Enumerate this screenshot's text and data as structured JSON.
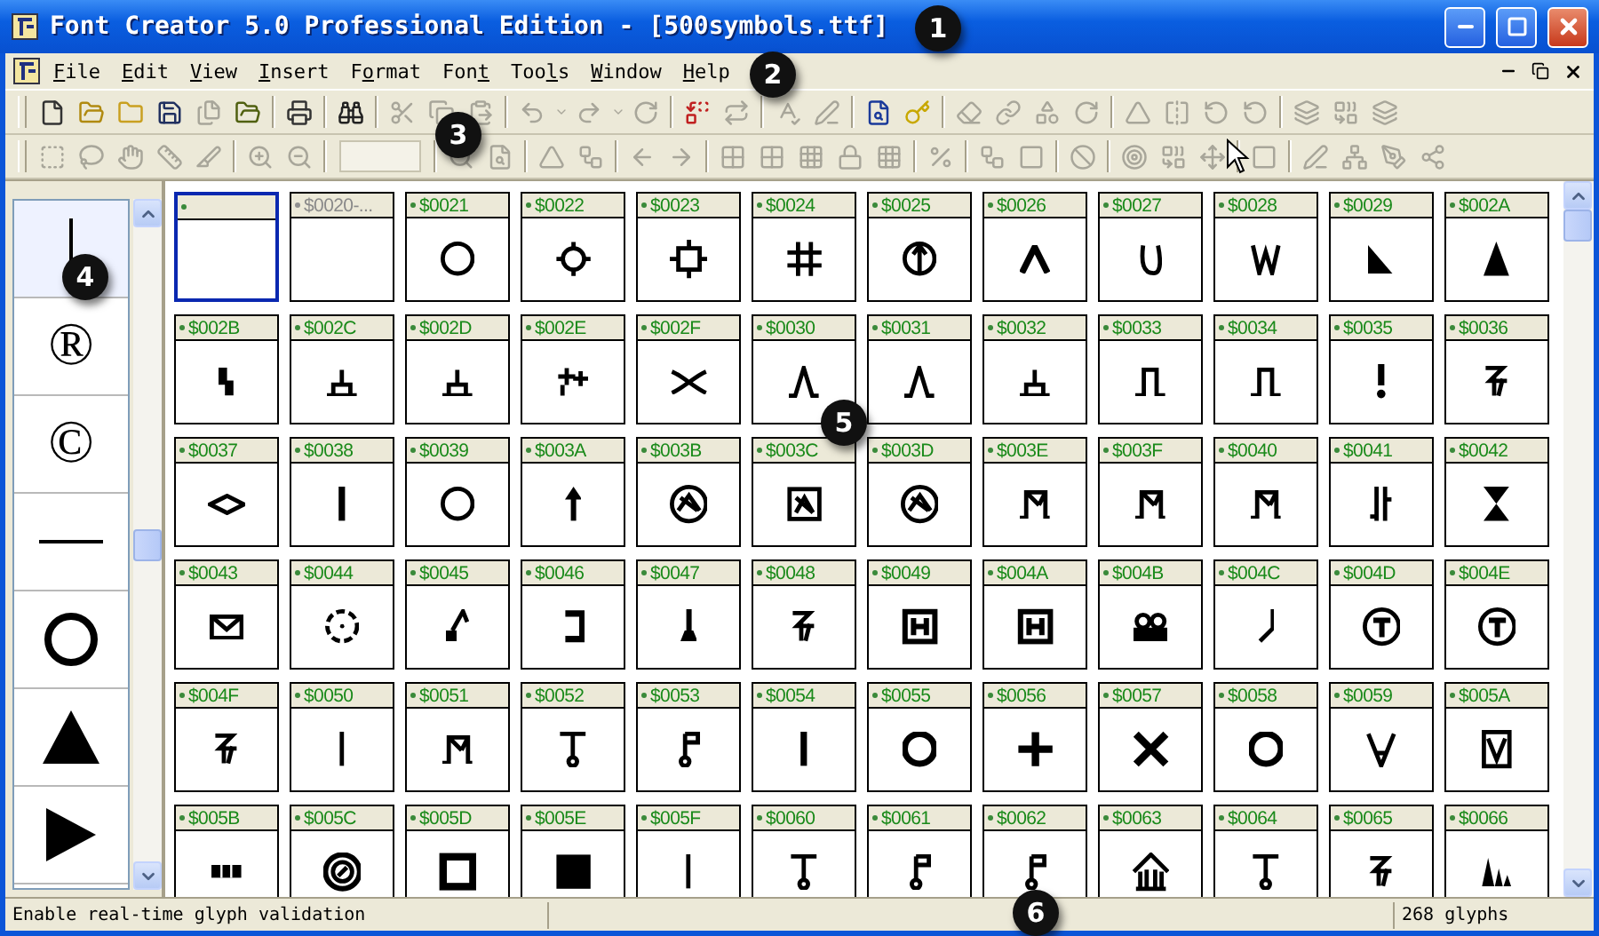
{
  "window": {
    "title": "Font Creator 5.0 Professional Edition - [500symbols.ttf]"
  },
  "menu": [
    {
      "key": "F",
      "post": "ile"
    },
    {
      "key": "E",
      "post": "dit"
    },
    {
      "key": "V",
      "post": "iew"
    },
    {
      "key": "I",
      "post": "nsert"
    },
    {
      "pre": "F",
      "key": "o",
      "post": "rmat"
    },
    {
      "pre": "Fon",
      "key": "t"
    },
    {
      "pre": "Too",
      "key": "l",
      "post": "s"
    },
    {
      "key": "W",
      "post": "indow"
    },
    {
      "key": "H",
      "post": "elp"
    }
  ],
  "toolbar_1": [
    {
      "kind": "new",
      "disabled": false
    },
    {
      "kind": "open-font",
      "disabled": false
    },
    {
      "kind": "open",
      "disabled": false
    },
    {
      "kind": "save",
      "disabled": false
    },
    {
      "kind": "save-all",
      "disabled": true
    },
    {
      "kind": "export",
      "disabled": false
    },
    {
      "kind": "separator"
    },
    {
      "kind": "print",
      "disabled": false
    },
    {
      "kind": "separator"
    },
    {
      "kind": "find",
      "disabled": false
    },
    {
      "kind": "separator"
    },
    {
      "kind": "cut",
      "disabled": true
    },
    {
      "kind": "copy",
      "disabled": true
    },
    {
      "kind": "paste",
      "disabled": true
    },
    {
      "kind": "separator"
    },
    {
      "kind": "undo",
      "disabled": true
    },
    {
      "kind": "dropdown",
      "disabled": true
    },
    {
      "kind": "redo",
      "disabled": true
    },
    {
      "kind": "dropdown",
      "disabled": true
    },
    {
      "kind": "refresh",
      "disabled": true
    },
    {
      "kind": "separator"
    },
    {
      "kind": "replace",
      "disabled": false
    },
    {
      "kind": "swap",
      "disabled": true
    },
    {
      "kind": "separator"
    },
    {
      "kind": "spell",
      "disabled": true
    },
    {
      "kind": "pen",
      "disabled": true
    },
    {
      "kind": "separator"
    },
    {
      "kind": "preview",
      "disabled": false
    },
    {
      "kind": "key",
      "disabled": false
    },
    {
      "kind": "separator"
    },
    {
      "kind": "eraser",
      "disabled": true
    },
    {
      "kind": "link",
      "disabled": true
    },
    {
      "kind": "shapes",
      "disabled": true
    },
    {
      "kind": "refresh",
      "disabled": true
    },
    {
      "kind": "separator"
    },
    {
      "kind": "triangle",
      "disabled": true
    },
    {
      "kind": "flip",
      "disabled": true
    },
    {
      "kind": "rotate",
      "disabled": true
    },
    {
      "kind": "rotate",
      "disabled": true
    },
    {
      "kind": "separator"
    },
    {
      "kind": "layers",
      "disabled": true
    },
    {
      "kind": "combine",
      "disabled": true
    },
    {
      "kind": "layers",
      "disabled": true
    }
  ],
  "toolbar_2": [
    {
      "kind": "select",
      "disabled": true
    },
    {
      "kind": "lasso",
      "disabled": true
    },
    {
      "kind": "hand",
      "disabled": true
    },
    {
      "kind": "ruler",
      "disabled": true
    },
    {
      "kind": "knife",
      "disabled": true
    },
    {
      "kind": "separator"
    },
    {
      "kind": "zoom-in",
      "disabled": true
    },
    {
      "kind": "zoom-out",
      "disabled": true
    },
    {
      "kind": "separator"
    },
    {
      "kind": "field",
      "disabled": true
    },
    {
      "kind": "separator"
    },
    {
      "kind": "search",
      "disabled": true
    },
    {
      "kind": "preview",
      "disabled": true
    },
    {
      "kind": "separator"
    },
    {
      "kind": "triangle",
      "disabled": true
    },
    {
      "kind": "nodes",
      "disabled": true
    },
    {
      "kind": "separator"
    },
    {
      "kind": "arrow-left",
      "disabled": true
    },
    {
      "kind": "arrow-right",
      "disabled": true
    },
    {
      "kind": "separator"
    },
    {
      "kind": "grid",
      "disabled": true
    },
    {
      "kind": "grid",
      "disabled": true
    },
    {
      "kind": "grid-fine",
      "disabled": true
    },
    {
      "kind": "lock",
      "disabled": true
    },
    {
      "kind": "grid-fine",
      "disabled": true
    },
    {
      "kind": "separator"
    },
    {
      "kind": "percent",
      "disabled": true
    },
    {
      "kind": "separator"
    },
    {
      "kind": "nodes",
      "disabled": true
    },
    {
      "kind": "square",
      "disabled": true
    },
    {
      "kind": "separator"
    },
    {
      "kind": "ban",
      "disabled": true
    },
    {
      "kind": "separator"
    },
    {
      "kind": "target",
      "disabled": true
    },
    {
      "kind": "combine",
      "disabled": true
    },
    {
      "kind": "move",
      "disabled": true
    },
    {
      "kind": "separator"
    },
    {
      "kind": "square",
      "disabled": true
    },
    {
      "kind": "separator"
    },
    {
      "kind": "pen",
      "disabled": true
    },
    {
      "kind": "network",
      "disabled": true
    },
    {
      "kind": "pen-tool",
      "disabled": true
    },
    {
      "kind": "share",
      "disabled": true
    }
  ],
  "preview": [
    {
      "kind": "vbar",
      "selected": true
    },
    {
      "kind": "char",
      "text": "®",
      "selected": false
    },
    {
      "kind": "char",
      "text": "©",
      "selected": false
    },
    {
      "kind": "hline",
      "selected": false
    },
    {
      "kind": "ring",
      "selected": false
    },
    {
      "kind": "triangle",
      "selected": false
    },
    {
      "kind": "play",
      "selected": false
    }
  ],
  "glyphs": [
    {
      "selected": true,
      "dimmed": false
    },
    {
      "label": "$0020-...",
      "selected": false,
      "dimmed": true
    },
    {
      "label": "$0021",
      "kind": "ring",
      "selected": false,
      "dimmed": false
    },
    {
      "label": "$0022",
      "kind": "ring-ticks",
      "selected": false,
      "dimmed": false
    },
    {
      "label": "$0023",
      "kind": "square-ticks",
      "selected": false,
      "dimmed": false
    },
    {
      "label": "$0024",
      "kind": "hash",
      "selected": false,
      "dimmed": false
    },
    {
      "label": "$0025",
      "kind": "ring-arrow",
      "selected": false,
      "dimmed": false
    },
    {
      "label": "$0026",
      "kind": "caret",
      "selected": false,
      "dimmed": false
    },
    {
      "label": "$0027",
      "kind": "cup",
      "selected": false,
      "dimmed": false
    },
    {
      "label": "$0028",
      "kind": "zigzag",
      "selected": false,
      "dimmed": false
    },
    {
      "label": "$0029",
      "kind": "right-triangle",
      "selected": false,
      "dimmed": false
    },
    {
      "label": "$002A",
      "kind": "triangle",
      "selected": false,
      "dimmed": false
    },
    {
      "label": "$002B",
      "kind": "step",
      "selected": false,
      "dimmed": false
    },
    {
      "label": "$002C",
      "kind": "branch",
      "selected": false,
      "dimmed": false
    },
    {
      "label": "$002D",
      "kind": "branch",
      "selected": false,
      "dimmed": false
    },
    {
      "label": "$002E",
      "kind": "plus-pair",
      "selected": false,
      "dimmed": false
    },
    {
      "label": "$002F",
      "kind": "curve-cross",
      "selected": false,
      "dimmed": false
    },
    {
      "label": "$0030",
      "kind": "peak",
      "selected": false,
      "dimmed": false
    },
    {
      "label": "$0031",
      "kind": "peak",
      "selected": false,
      "dimmed": false
    },
    {
      "label": "$0032",
      "kind": "branch",
      "selected": false,
      "dimmed": false
    },
    {
      "label": "$0033",
      "kind": "pulse",
      "selected": false,
      "dimmed": false
    },
    {
      "label": "$0034",
      "kind": "pulse",
      "selected": false,
      "dimmed": false
    },
    {
      "label": "$0035",
      "kind": "exclaim",
      "selected": false,
      "dimmed": false
    },
    {
      "label": "$0036",
      "kind": "squiggle",
      "selected": false,
      "dimmed": false
    },
    {
      "label": "$0037",
      "kind": "diamond",
      "selected": false,
      "dimmed": false
    },
    {
      "label": "$0038",
      "kind": "bar",
      "selected": false,
      "dimmed": false
    },
    {
      "label": "$0039",
      "kind": "ring",
      "selected": false,
      "dimmed": false
    },
    {
      "label": "$003A",
      "kind": "arrow-up",
      "selected": false,
      "dimmed": false
    },
    {
      "label": "$003B",
      "kind": "ring-cross",
      "selected": false,
      "dimmed": false
    },
    {
      "label": "$003C",
      "kind": "box-cross",
      "selected": false,
      "dimmed": false
    },
    {
      "label": "$003D",
      "kind": "ring-cross",
      "selected": false,
      "dimmed": false
    },
    {
      "label": "$003E",
      "kind": "gate",
      "selected": false,
      "dimmed": false
    },
    {
      "label": "$003F",
      "kind": "gate",
      "selected": false,
      "dimmed": false
    },
    {
      "label": "$0040",
      "kind": "gate",
      "selected": false,
      "dimmed": false
    },
    {
      "label": "$0041",
      "kind": "double-bar",
      "selected": false,
      "dimmed": false
    },
    {
      "label": "$0042",
      "kind": "hourglass",
      "selected": false,
      "dimmed": false
    },
    {
      "label": "$0043",
      "kind": "envelope",
      "selected": false,
      "dimmed": false
    },
    {
      "label": "$0044",
      "kind": "dashed-ring",
      "selected": false,
      "dimmed": false
    },
    {
      "label": "$0045",
      "kind": "hammer",
      "selected": false,
      "dimmed": false
    },
    {
      "label": "$0046",
      "kind": "bracket",
      "selected": false,
      "dimmed": false
    },
    {
      "label": "$0047",
      "kind": "pin",
      "selected": false,
      "dimmed": false
    },
    {
      "label": "$0048",
      "kind": "squiggle",
      "selected": false,
      "dimmed": false
    },
    {
      "label": "$0049",
      "kind": "boxed-bars",
      "selected": false,
      "dimmed": false
    },
    {
      "label": "$004A",
      "kind": "boxed-bars",
      "selected": false,
      "dimmed": false
    },
    {
      "label": "$004B",
      "kind": "reels",
      "selected": false,
      "dimmed": false
    },
    {
      "label": "$004C",
      "kind": "hook",
      "selected": false,
      "dimmed": false
    },
    {
      "label": "$004D",
      "kind": "ring-bars",
      "selected": false,
      "dimmed": false
    },
    {
      "label": "$004E",
      "kind": "ring-bars",
      "selected": false,
      "dimmed": false
    },
    {
      "label": "$004F",
      "kind": "squiggle",
      "selected": false,
      "dimmed": false
    },
    {
      "label": "$0050",
      "kind": "bar-thin",
      "selected": false,
      "dimmed": false
    },
    {
      "label": "$0051",
      "kind": "gate",
      "selected": false,
      "dimmed": false
    },
    {
      "label": "$0052",
      "kind": "lollipop",
      "selected": false,
      "dimmed": false
    },
    {
      "label": "$0053",
      "kind": "flag",
      "selected": false,
      "dimmed": false
    },
    {
      "label": "$0054",
      "kind": "bar",
      "selected": false,
      "dimmed": false
    },
    {
      "label": "$0055",
      "kind": "ring-thick",
      "selected": false,
      "dimmed": false
    },
    {
      "label": "$0056",
      "kind": "plus",
      "selected": false,
      "dimmed": false
    },
    {
      "label": "$0057",
      "kind": "cross",
      "selected": false,
      "dimmed": false
    },
    {
      "label": "$0058",
      "kind": "ring-thick",
      "selected": false,
      "dimmed": false
    },
    {
      "label": "$0059",
      "kind": "v-mark",
      "selected": false,
      "dimmed": false
    },
    {
      "label": "$005A",
      "kind": "box-v",
      "selected": false,
      "dimmed": false
    },
    {
      "label": "$005B",
      "kind": "dashes",
      "selected": false,
      "dimmed": false
    },
    {
      "label": "$005C",
      "kind": "ring-slash",
      "selected": false,
      "dimmed": false
    },
    {
      "label": "$005D",
      "kind": "square",
      "selected": false,
      "dimmed": false
    },
    {
      "label": "$005E",
      "kind": "filled-square",
      "selected": false,
      "dimmed": false
    },
    {
      "label": "$005F",
      "kind": "bar-thin",
      "selected": false,
      "dimmed": false
    },
    {
      "label": "$0060",
      "kind": "lollipop",
      "selected": false,
      "dimmed": false
    },
    {
      "label": "$0061",
      "kind": "flag",
      "selected": false,
      "dimmed": false
    },
    {
      "label": "$0062",
      "kind": "flag",
      "selected": false,
      "dimmed": false
    },
    {
      "label": "$0063",
      "kind": "house",
      "selected": false,
      "dimmed": false
    },
    {
      "label": "$0064",
      "kind": "lollipop",
      "selected": false,
      "dimmed": false
    },
    {
      "label": "$0065",
      "kind": "squiggle",
      "selected": false,
      "dimmed": false
    },
    {
      "label": "$0066",
      "kind": "peaks",
      "selected": false,
      "dimmed": false
    }
  ],
  "status_bar": {
    "message": "Enable real-time glyph validation",
    "count": "268 glyphs"
  },
  "callouts": [
    "1",
    "2",
    "3",
    "4",
    "5",
    "6"
  ]
}
